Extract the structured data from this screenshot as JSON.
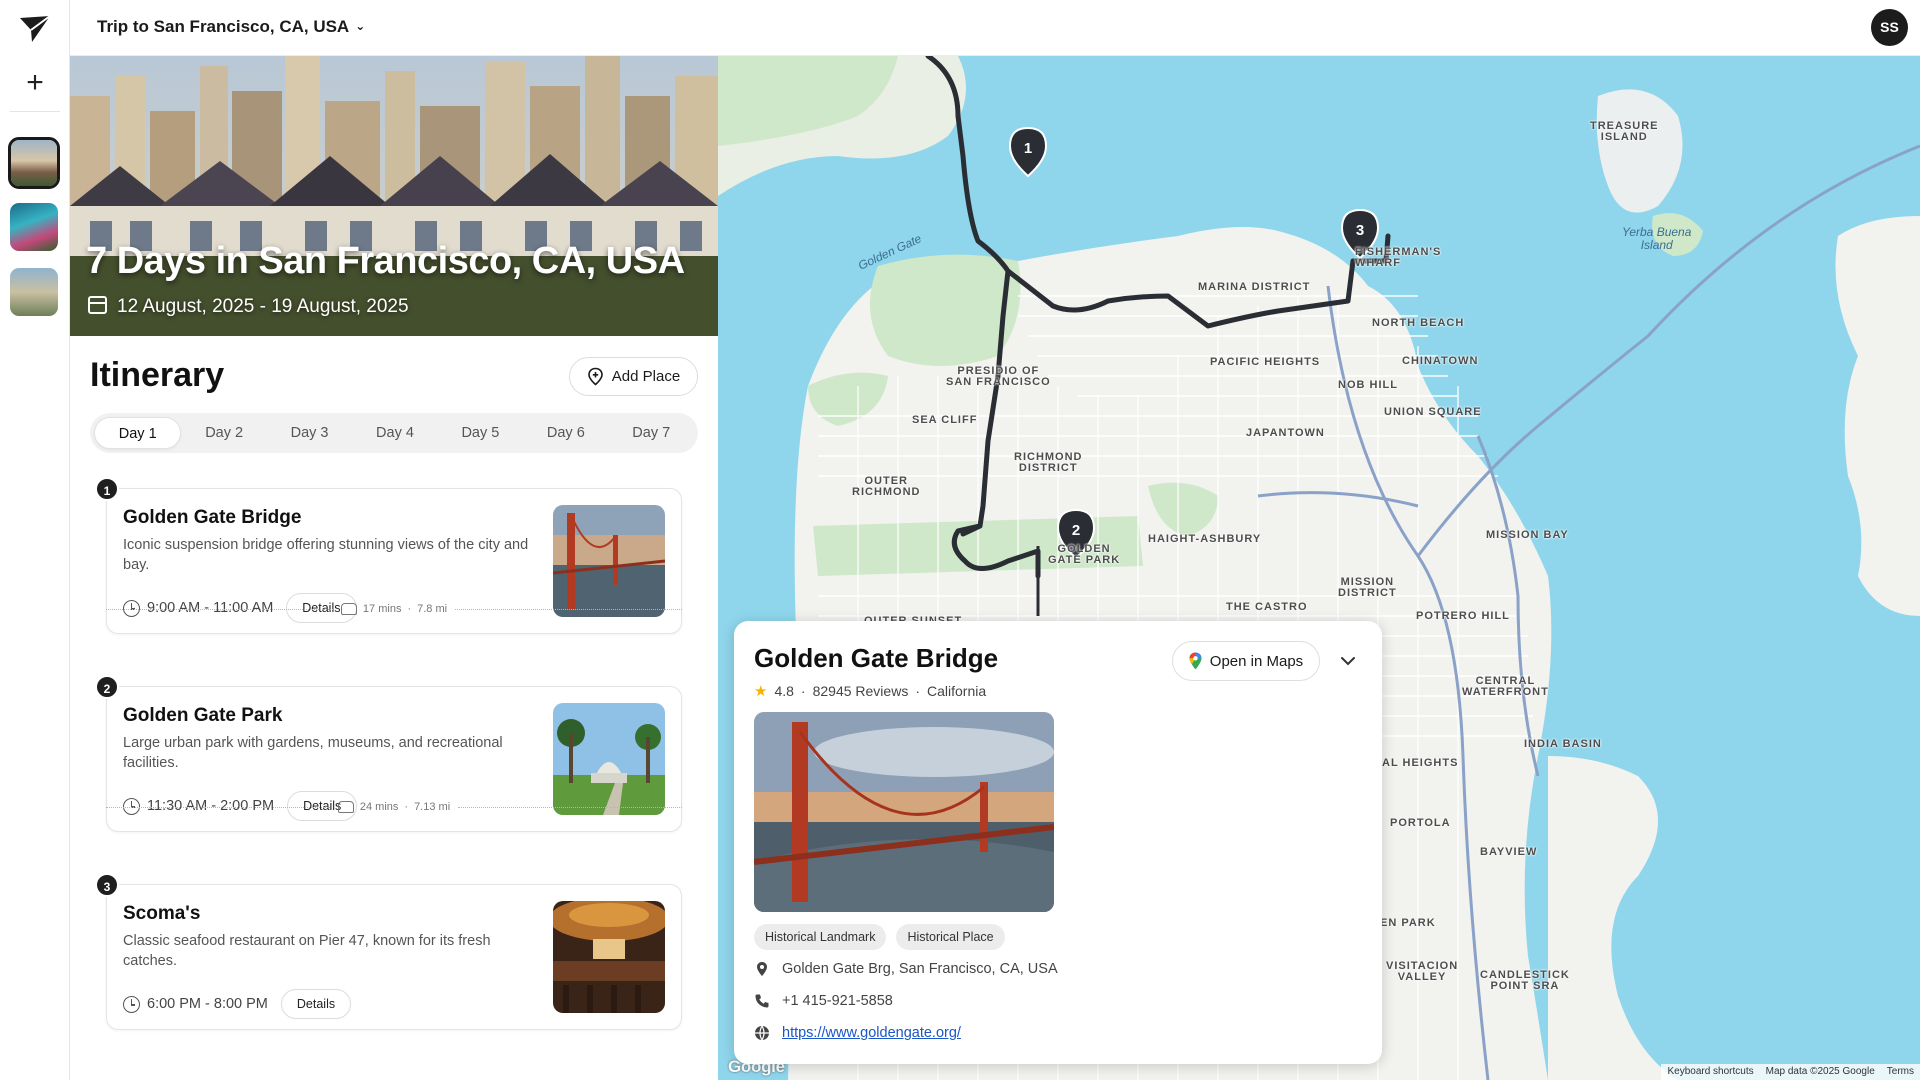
{
  "trip": {
    "selector_label": "Trip to San Francisco, CA, USA"
  },
  "user": {
    "initials": "SS"
  },
  "hero": {
    "title": "7 Days in San Francisco, CA, USA",
    "dates": "12 August, 2025 - 19 August, 2025"
  },
  "itinerary": {
    "heading": "Itinerary",
    "add_place_label": "Add Place",
    "days": [
      "Day 1",
      "Day 2",
      "Day 3",
      "Day 4",
      "Day 5",
      "Day 6",
      "Day 7"
    ],
    "active_day": "Day 1",
    "stops": [
      {
        "number": "1",
        "name": "Golden Gate Bridge",
        "description": "Iconic suspension bridge offering stunning views of the city and bay.",
        "time": "9:00 AM - 11:00 AM",
        "details_label": "Details"
      },
      {
        "number": "2",
        "name": "Golden Gate Park",
        "description": "Large urban park with gardens, museums, and recreational facilities.",
        "time": "11:30 AM - 2:00 PM",
        "details_label": "Details"
      },
      {
        "number": "3",
        "name": "Scoma's",
        "description": "Classic seafood restaurant on Pier 47, known for its fresh catches.",
        "time": "6:00 PM - 8:00 PM",
        "details_label": "Details"
      }
    ],
    "travel": [
      {
        "duration": "17 mins",
        "distance": "7.8 mi"
      },
      {
        "duration": "24 mins",
        "distance": "7.13 mi"
      }
    ]
  },
  "place_card": {
    "name": "Golden Gate Bridge",
    "rating": "4.8",
    "reviews": "82945 Reviews",
    "region": "California",
    "open_maps_label": "Open in Maps",
    "tags": [
      "Historical Landmark",
      "Historical Place"
    ],
    "address": "Golden Gate Brg, San Francisco, CA, USA",
    "phone": "+1 415-921-5858",
    "website": "https://www.goldengate.org/"
  },
  "map": {
    "markers": [
      "1",
      "2",
      "3"
    ],
    "labels": {
      "treasure_island": "TREASURE\nISLAND",
      "yerba_buena": "Yerba Buena\nIsland",
      "golden_gate": "Golden Gate",
      "fishermans_wharf": "FISHERMAN'S\nWHARF",
      "marina": "MARINA DISTRICT",
      "north_beach": "NORTH BEACH",
      "chinatown": "CHINATOWN",
      "pacific_heights": "PACIFIC HEIGHTS",
      "nob_hill": "NOB HILL",
      "presidio": "PRESIDIO OF\nSAN FRANCISCO",
      "union_square": "UNION SQUARE",
      "japantown": "JAPANTOWN",
      "sea_cliff": "SEA CLIFF",
      "richmond": "RICHMOND\nDISTRICT",
      "outer_richmond": "OUTER\nRICHMOND",
      "haight": "HAIGHT-ASHBURY",
      "mission_bay": "MISSION BAY",
      "golden_gate_park": "GOLDEN\nGATE PARK",
      "mission_district": "MISSION\nDISTRICT",
      "castro": "THE CASTRO",
      "potrero": "POTRERO HILL",
      "outer_sunset": "OUTER SUNSET",
      "central_waterfront": "CENTRAL\nWATERFRONT",
      "india_basin": "INDIA BASIN",
      "bernal": "AL HEIGHTS",
      "portola": "PORTOLA",
      "bayview": "BAYVIEW",
      "glen_park": "EN PARK",
      "visitacion": "VISITACION\nVALLEY",
      "candlestick": "CANDLESTICK\nPOINT SRA"
    },
    "google_logo": "Google",
    "footer": [
      "Keyboard shortcuts",
      "Map data ©2025 Google",
      "Terms"
    ]
  }
}
